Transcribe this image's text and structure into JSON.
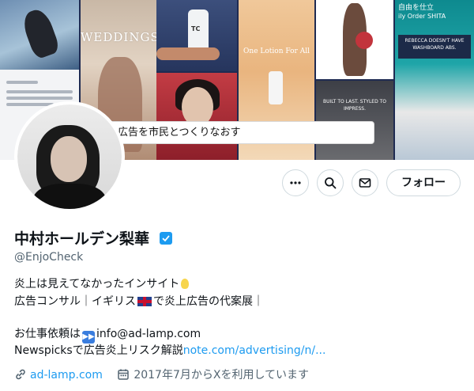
{
  "banner": {
    "caption": "広告を市民とつくりなおす",
    "collage": {
      "weddings_text": "WEDDINGS",
      "lotion_text": "One Lotion For All",
      "bottle_label": "TC",
      "built_text": "BUILT TO LAST. STYLED TO IMPRESS.",
      "top_right_text": "自由を仕立",
      "top_right_sub": "ily Order SHITA",
      "banner_text": "REBECCA DOESN'T HAVE WASHBOARD ABS."
    }
  },
  "actions": {
    "more_icon": "more-horizontal-icon",
    "search_icon": "search-icon",
    "message_icon": "mail-icon",
    "follow_label": "フォロー"
  },
  "profile": {
    "display_name": "中村ホールデン梨華",
    "verified_icon": "verified-badge-icon",
    "handle": "@EnjoCheck",
    "bio": {
      "line1": "炎上は見えてなかったインサイト",
      "line2_prefix": "広告コンサル｜イギリス",
      "line2_suffix": "で炎上広告の代案展｜",
      "line3_prefix": "お仕事依頼は",
      "line3_email": "info@ad-lamp.com",
      "line4_prefix": "Newspicksで広告炎上リスク解説",
      "line4_link": "note.com/advertising/n/..."
    },
    "website": "ad-lamp.com",
    "joined": "2017年7月からXを利用しています"
  },
  "colors": {
    "accent": "#1d9bf0",
    "text": "#0f1419",
    "secondary": "#536471"
  }
}
